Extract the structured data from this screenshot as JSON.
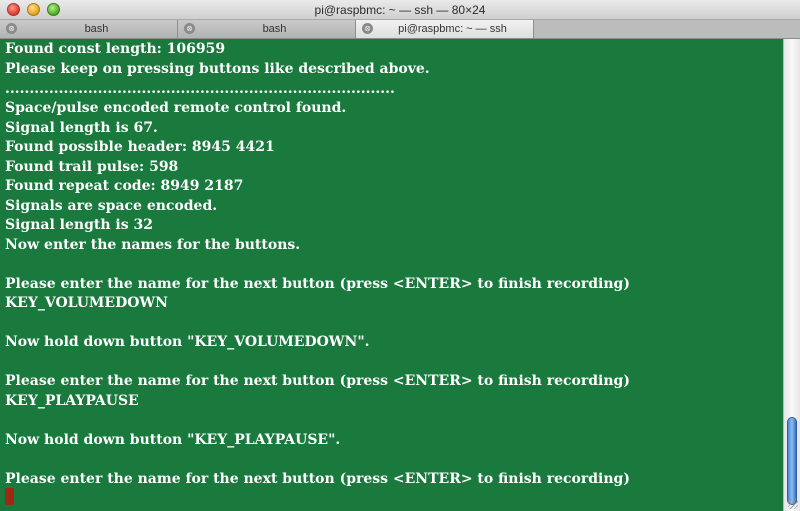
{
  "window": {
    "title": "pi@raspbmc: ~ — ssh — 80×24"
  },
  "tabs": [
    {
      "label": "bash",
      "active": false,
      "close_glyph": "⊗"
    },
    {
      "label": "bash",
      "active": false,
      "close_glyph": "⊗"
    },
    {
      "label": "pi@raspbmc: ~ — ssh",
      "active": true,
      "close_glyph": "⊗"
    }
  ],
  "terminal": {
    "background": "#1a7a3e",
    "foreground": "#ffffff",
    "cursor_color": "#9c2a16",
    "lines": [
      "Found const length: 106959",
      "Please keep on pressing buttons like described above.",
      "................................................................................",
      "Space/pulse encoded remote control found.",
      "Signal length is 67.",
      "Found possible header: 8945 4421",
      "Found trail pulse: 598",
      "Found repeat code: 8949 2187",
      "Signals are space encoded.",
      "Signal length is 32",
      "Now enter the names for the buttons.",
      "",
      "Please enter the name for the next button (press <ENTER> to finish recording)",
      "KEY_VOLUMEDOWN",
      "",
      "Now hold down button \"KEY_VOLUMEDOWN\".",
      "",
      "Please enter the name for the next button (press <ENTER> to finish recording)",
      "KEY_PLAYPAUSE",
      "",
      "Now hold down button \"KEY_PLAYPAUSE\".",
      "",
      "Please enter the name for the next button (press <ENTER> to finish recording)"
    ]
  },
  "icons": {
    "window_close": "close-icon",
    "window_minimize": "minimize-icon",
    "window_zoom": "zoom-icon",
    "tab_close": "tab-close-icon",
    "resize": "resize-grip-icon"
  }
}
